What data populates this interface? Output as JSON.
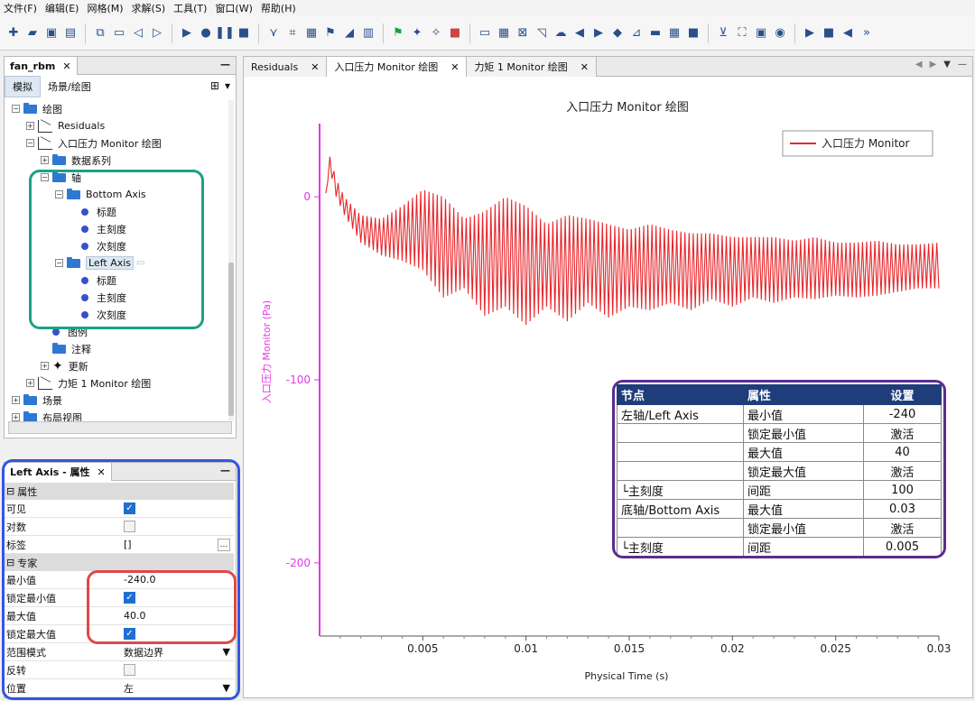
{
  "menu": [
    "文件(F)",
    "编辑(E)",
    "网格(M)",
    "求解(S)",
    "工具(T)",
    "窗口(W)",
    "帮助(H)"
  ],
  "tree_panel": {
    "tab_label": "fan_rbm",
    "subtab_sim": "模拟",
    "subtab_scene": "场景/绘图",
    "nodes": [
      {
        "label": "绘图",
        "kind": "folder",
        "exp": "−"
      },
      {
        "label": "Residuals",
        "kind": "plot",
        "exp": "+"
      },
      {
        "label": "入口压力 Monitor 绘图",
        "kind": "plot",
        "exp": "−"
      },
      {
        "label": "数据系列",
        "kind": "folder",
        "exp": "+"
      },
      {
        "label": "轴",
        "kind": "folder",
        "exp": "−"
      },
      {
        "label": "Bottom Axis",
        "kind": "folder",
        "exp": "−"
      },
      {
        "label": "标题",
        "kind": "dot"
      },
      {
        "label": "主刻度",
        "kind": "dot"
      },
      {
        "label": "次刻度",
        "kind": "dot"
      },
      {
        "label": "Left Axis",
        "kind": "folder",
        "exp": "−"
      },
      {
        "label": "标题",
        "kind": "dot"
      },
      {
        "label": "主刻度",
        "kind": "dot"
      },
      {
        "label": "次刻度",
        "kind": "dot"
      },
      {
        "label": "图例",
        "kind": "dot"
      },
      {
        "label": "注释",
        "kind": "folder"
      },
      {
        "label": "更新",
        "kind": "run",
        "exp": "+"
      },
      {
        "label": "力矩 1 Monitor 绘图",
        "kind": "plot",
        "exp": "+"
      },
      {
        "label": "场景",
        "kind": "folder",
        "exp": "+"
      },
      {
        "label": "布局视图",
        "kind": "folder",
        "exp": "+"
      }
    ]
  },
  "props_panel": {
    "tab_label": "Left Axis - 属性",
    "section_props": "属性",
    "visible_label": "可见",
    "log_label": "对数",
    "tag_label": "标签",
    "tag_value": "[]",
    "section_expert": "专家",
    "min_label": "最小值",
    "min_value": "-240.0",
    "lock_min_label": "锁定最小值",
    "max_label": "最大值",
    "max_value": "40.0",
    "lock_max_label": "锁定最大值",
    "range_mode_label": "范围模式",
    "range_mode_value": "数据边界",
    "reverse_label": "反转",
    "position_label": "位置",
    "position_value": "左"
  },
  "editor_tabs": [
    "Residuals",
    "入口压力 Monitor 绘图",
    "力矩 1 Monitor 绘图"
  ],
  "chart_data": {
    "type": "line",
    "title": "入口压力 Monitor 绘图",
    "xlabel": "Physical Time (s)",
    "ylabel": "入口压力 Monitor (Pa)",
    "xlim": [
      0,
      0.03
    ],
    "ylim": [
      -240,
      40
    ],
    "xticks": [
      0.005,
      0.01,
      0.015,
      0.02,
      0.025,
      0.03
    ],
    "xtick_labels": [
      "0.005",
      "0.01",
      "0.015",
      "0.02",
      "0.025",
      "0.03"
    ],
    "yticks": [
      0,
      -100,
      -200
    ],
    "ytick_labels": [
      "0",
      "-100",
      "-200"
    ],
    "legend": "top-right",
    "grid": false,
    "series": [
      {
        "name": "入口压力 Monitor",
        "color": "#e8262b",
        "kind": "oscillating",
        "envelope_x": [
          0.0003,
          0.0005,
          0.0008,
          0.0012,
          0.002,
          0.003,
          0.004,
          0.005,
          0.006,
          0.007,
          0.008,
          0.009,
          0.01,
          0.011,
          0.012,
          0.013,
          0.014,
          0.015,
          0.016,
          0.017,
          0.018,
          0.019,
          0.02,
          0.021,
          0.022,
          0.023,
          0.024,
          0.025,
          0.026,
          0.027,
          0.028,
          0.029,
          0.03
        ],
        "envelope_high": [
          2,
          22,
          10,
          0,
          -10,
          -12,
          -5,
          4,
          0,
          -12,
          -8,
          0,
          -5,
          -15,
          -10,
          -12,
          -15,
          -18,
          -15,
          -18,
          -20,
          -20,
          -22,
          -22,
          -22,
          -24,
          -22,
          -25,
          -25,
          -24,
          -26,
          -26,
          -25
        ],
        "envelope_low": [
          2,
          15,
          0,
          -10,
          -25,
          -32,
          -35,
          -40,
          -55,
          -50,
          -65,
          -60,
          -70,
          -60,
          -68,
          -58,
          -66,
          -60,
          -62,
          -58,
          -62,
          -56,
          -60,
          -55,
          -58,
          -55,
          -56,
          -54,
          -55,
          -54,
          -52,
          -50,
          -50
        ],
        "osc_period": 0.0002
      }
    ]
  },
  "note_table": {
    "headers": [
      "节点",
      "属性",
      "设置"
    ],
    "rows": [
      [
        "左轴/Left Axis",
        "最小值",
        "-240"
      ],
      [
        "",
        "锁定最小值",
        "激活"
      ],
      [
        "",
        "最大值",
        "40"
      ],
      [
        "",
        "锁定最大值",
        "激活"
      ],
      [
        "└主刻度",
        "间距",
        "100"
      ],
      [
        "底轴/Bottom Axis",
        "最大值",
        "0.03"
      ],
      [
        "",
        "锁定最小值",
        "激活"
      ],
      [
        "└主刻度",
        "间距",
        "0.005"
      ]
    ]
  },
  "colors": {
    "teal": "#1aa283",
    "blue": "#3156e4",
    "red": "#e04848",
    "purple": "#5b2d8e",
    "axis_magenta": "#e535e6"
  }
}
